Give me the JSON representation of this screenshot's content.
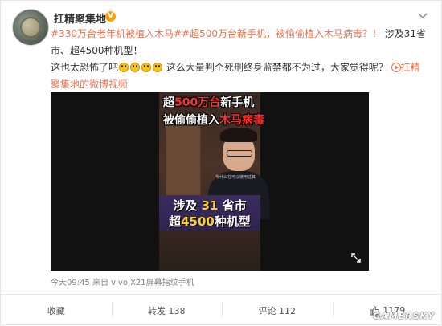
{
  "post": {
    "username": "扛精聚集地",
    "verified_badge": "V",
    "text": {
      "part1_hashtag": "#330万台老年机被植入木马#",
      "part2_hashtag": "#超500万台新手机，被偷偷植入木马病毒？！",
      "part3": " 涉及31省市、超4500种机型！",
      "line2_a": "这也太恐怖了吧",
      "line2_b": " 这么大量判个死刑终身监禁都不为过，大家觉得呢？",
      "video_link": "扛精聚集地的微博视频"
    },
    "meta": "今天09:45 来自 vivo X21屏幕指纹手机"
  },
  "video": {
    "title_line1_a": "超",
    "title_line1_b": "500万台",
    "title_line1_c": "新手机",
    "title_line2_a": "被偷偷植入",
    "title_line2_b": "木马病毒",
    "sub_line1_a": "涉及",
    "sub_line1_b": "31",
    "sub_line1_c": "省市",
    "sub_line2_a": "超",
    "sub_line2_b": "4500",
    "sub_line2_c": "种机型",
    "caption_small": "专什么在可以使用过其"
  },
  "actions": {
    "favorite": "收藏",
    "repost": "转发 138",
    "comment": "评论 112",
    "like": "1179"
  },
  "watermark": "GAMERSKY",
  "colors": {
    "link": "#eb7350",
    "video_red": "#ff2d2d",
    "video_yellow": "#ffd21f"
  }
}
